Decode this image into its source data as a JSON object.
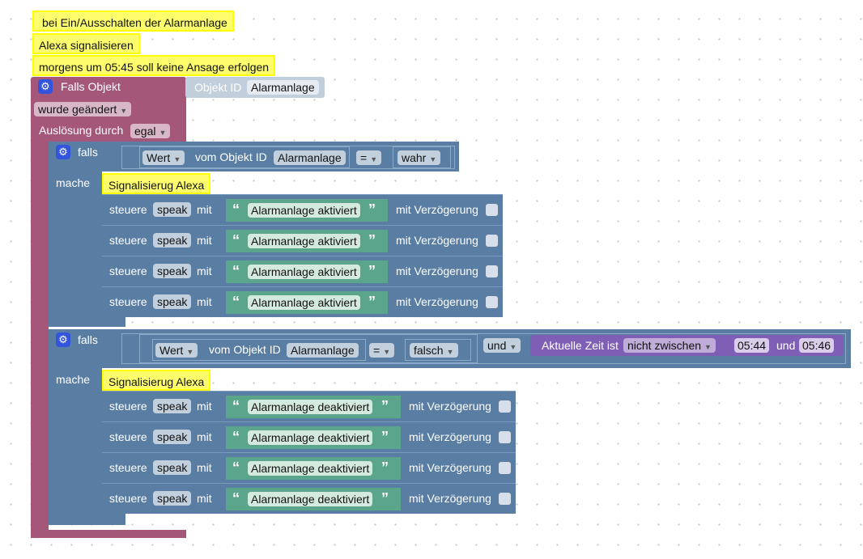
{
  "comments": {
    "c1": "bei Ein/Ausschalten der Alarmanlage",
    "c2": "Alexa signalisieren",
    "c3": "morgens um 05:45 soll keine Ansage erfolgen"
  },
  "trigger": {
    "label": "Falls Objekt",
    "object_id_label": "Objekt ID",
    "object_id_value": "Alarmanlage",
    "change_option": "wurde geändert",
    "trigger_by_label": "Auslösung durch",
    "trigger_by_value": "egal"
  },
  "if1": {
    "falls": "falls",
    "mache": "mache",
    "value_option": "Wert",
    "vom_label": "vom Objekt ID",
    "object": "Alarmanlage",
    "op": "=",
    "compare": "wahr",
    "comment": "Signalisierug Alexa",
    "rows": [
      {
        "steuere": "steuere",
        "device": "speak",
        "mit": "mit",
        "text": "Alarmanlage aktiviert",
        "delay": "mit Verzögerung"
      },
      {
        "steuere": "steuere",
        "device": "speak",
        "mit": "mit",
        "text": "Alarmanlage aktiviert",
        "delay": "mit Verzögerung"
      },
      {
        "steuere": "steuere",
        "device": "speak",
        "mit": "mit",
        "text": "Alarmanlage aktiviert",
        "delay": "mit Verzögerung"
      },
      {
        "steuere": "steuere",
        "device": "speak",
        "mit": "mit",
        "text": "Alarmanlage aktiviert",
        "delay": "mit Verzögerung"
      }
    ]
  },
  "if2": {
    "falls": "falls",
    "mache": "mache",
    "value_option": "Wert",
    "vom_label": "vom Objekt ID",
    "object": "Alarmanlage",
    "op": "=",
    "compare": "falsch",
    "logic": "und",
    "time_label": "Aktuelle Zeit ist",
    "time_option": "nicht zwischen",
    "time_from": "05:44",
    "time_and": "und",
    "time_to": "05:46",
    "comment": "Signalisierug Alexa",
    "rows": [
      {
        "steuere": "steuere",
        "device": "speak",
        "mit": "mit",
        "text": "Alarmanlage deaktiviert",
        "delay": "mit Verzögerung"
      },
      {
        "steuere": "steuere",
        "device": "speak",
        "mit": "mit",
        "text": "Alarmanlage deaktiviert",
        "delay": "mit Verzögerung"
      },
      {
        "steuere": "steuere",
        "device": "speak",
        "mit": "mit",
        "text": "Alarmanlage deaktiviert",
        "delay": "mit Verzögerung"
      },
      {
        "steuere": "steuere",
        "device": "speak",
        "mit": "mit",
        "text": "Alarmanlage deaktiviert",
        "delay": "mit Verzögerung"
      }
    ]
  },
  "colors": {
    "trigger": "#a5577a",
    "control": "#5a7ea3",
    "string": "#5ba58c",
    "time": "#7f5fb5",
    "comment": "#fefe6c"
  }
}
